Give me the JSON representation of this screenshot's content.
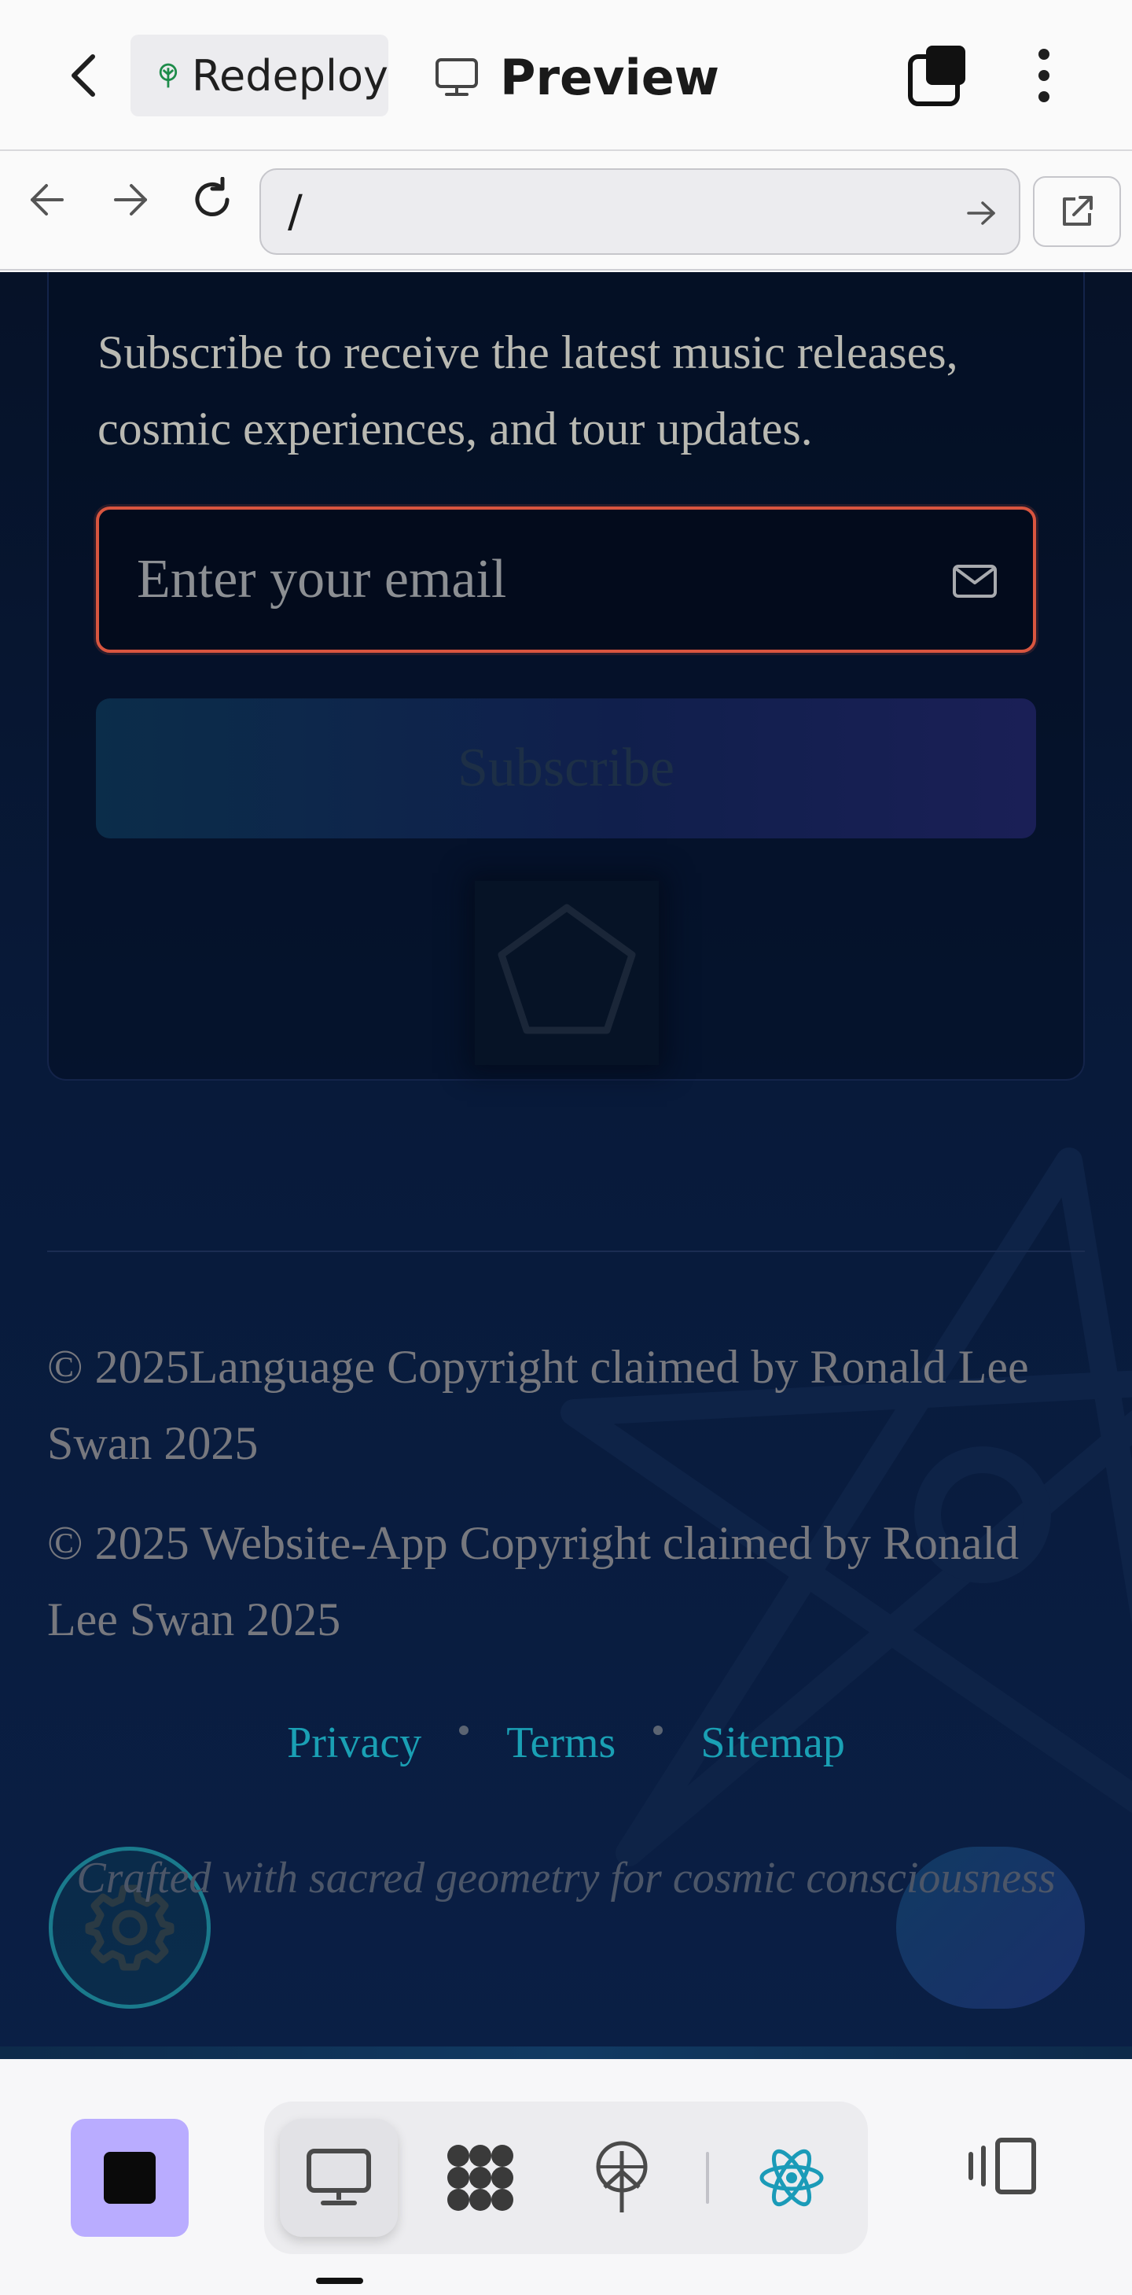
{
  "topbar": {
    "tab_label": "Redeploy",
    "preview_label": "Preview"
  },
  "navbar": {
    "url": "/"
  },
  "newsletter": {
    "description": "Subscribe to receive the latest music releases, cosmic experiences, and tour updates.",
    "email_placeholder": "Enter your email",
    "email_value": "",
    "subscribe_label": "Subscribe"
  },
  "footer": {
    "copyright_language": "© 2025Language Copyright claimed by Ronald Lee Swan 2025",
    "copyright_website": "© 2025 Website-App Copyright claimed by Ronald Lee Swan 2025",
    "links": [
      "Privacy",
      "Terms",
      "Sitemap"
    ],
    "tagline": "Crafted with sacred geometry for cosmic consciousness"
  },
  "colors": {
    "accent_link": "#1aa0b4",
    "error_border": "#d8553f",
    "stop_button": "#b9acff",
    "react_icon": "#1b9bb8"
  },
  "icons": {
    "back": "chevron-left-icon",
    "tab_favicon": "tree-icon",
    "preview": "monitor-icon",
    "tabs": "tab-switcher-icon",
    "menu": "more-vertical-icon",
    "nav_back": "arrow-left-icon",
    "nav_forward": "arrow-right-icon",
    "reload": "reload-icon",
    "go": "arrow-right-icon",
    "open_external": "external-link-icon",
    "mail": "mail-icon",
    "pentagon": "pentagon-icon",
    "settings": "gear-icon",
    "toolbar": [
      "monitor-icon",
      "network-icon",
      "deploy-icon",
      "react-icon"
    ],
    "side_panel": "side-panel-icon"
  }
}
